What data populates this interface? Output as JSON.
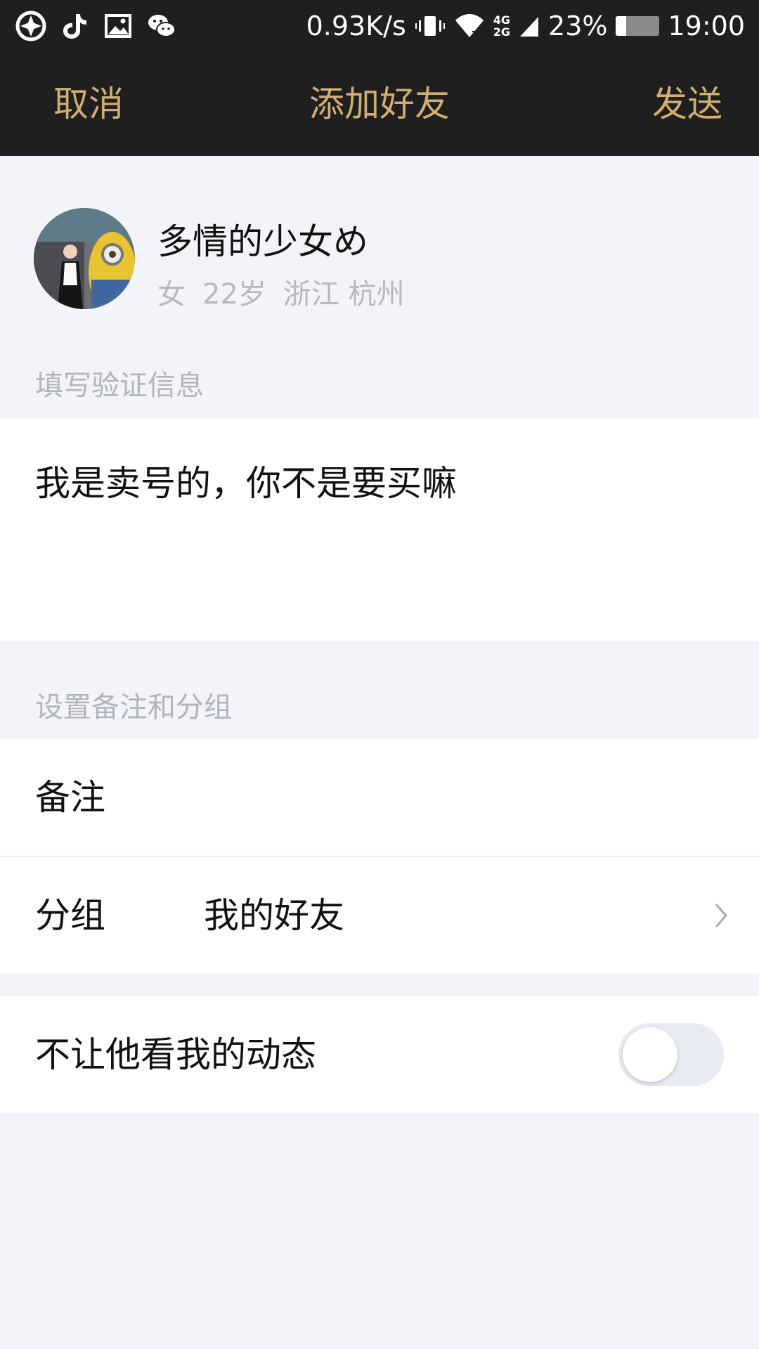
{
  "status_bar": {
    "network_speed": "0.93K/s",
    "network_type_top": "4G",
    "network_type_bottom": "2G",
    "battery_percent": "23%",
    "battery_level": 0.23,
    "time": "19:00",
    "left_icons": [
      "aperture-icon",
      "tiktok-icon",
      "gallery-icon",
      "wechat-icon"
    ]
  },
  "nav": {
    "cancel_label": "取消",
    "title": "添加好友",
    "send_label": "发送"
  },
  "profile": {
    "name": "多情的少女め",
    "gender": "女",
    "age": "22岁",
    "province": "浙江",
    "city": "杭州"
  },
  "verification": {
    "section_label": "填写验证信息",
    "message": "我是卖号的，你不是要买嘛"
  },
  "remark_group": {
    "section_label": "设置备注和分组",
    "remark_label": "备注",
    "remark_value": "",
    "group_label": "分组",
    "group_value": "我的好友"
  },
  "privacy": {
    "hide_moments_label": "不让他看我的动态",
    "hide_moments_enabled": false
  },
  "colors": {
    "accent": "#d2ad6f",
    "header_bg": "#1f1f20",
    "page_bg": "#f3f4f8",
    "muted_text": "#b2b5bd"
  }
}
